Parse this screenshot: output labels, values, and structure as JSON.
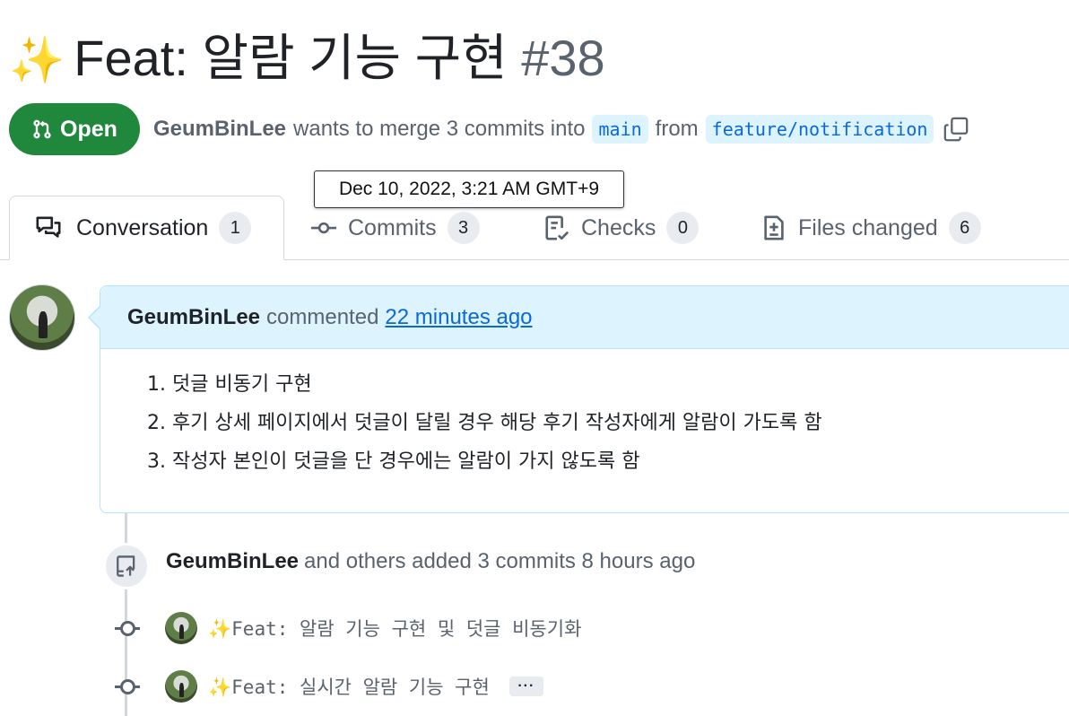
{
  "pr": {
    "title": "Feat: 알람 기능 구현",
    "title_emoji": "✨",
    "number": "#38",
    "state": "Open",
    "author": "GeumBinLee",
    "merge_text": "wants to merge 3 commits into",
    "base_branch": "main",
    "from_text": "from",
    "head_branch": "feature/notification"
  },
  "tooltip": {
    "text": "Dec 10, 2022, 3:21 AM GMT+9"
  },
  "tabs": [
    {
      "label": "Conversation",
      "count": "1",
      "icon": "comment-discussion-icon",
      "active": true
    },
    {
      "label": "Commits",
      "count": "3",
      "icon": "git-commit-icon",
      "active": false
    },
    {
      "label": "Checks",
      "count": "0",
      "icon": "checklist-icon",
      "active": false
    },
    {
      "label": "Files changed",
      "count": "6",
      "icon": "file-diff-icon",
      "active": false
    }
  ],
  "comment": {
    "author": "GeumBinLee",
    "action": "commented",
    "time": "22 minutes ago",
    "items": [
      "1. 덧글 비동기 구현",
      "2. 후기 상세 페이지에서 덧글이 달릴 경우 해당 후기 작성자에게 알람이 가도록 함",
      "3. 작성자 본인이 덧글을 단 경우에는 알람이 가지 않도록 함"
    ]
  },
  "event": {
    "author": "GeumBinLee",
    "text": "and others added 3 commits 8 hours ago"
  },
  "commits": [
    {
      "emoji": "✨",
      "message": "Feat: 알람 기능 구현 및 덧글 비동기화"
    },
    {
      "emoji": "✨",
      "message": "Feat: 실시간 알람 기능 구현",
      "ellipsis": "···"
    }
  ],
  "colors": {
    "open_green": "#1f883d",
    "link_blue": "#0969da",
    "comment_header_bg": "#ddf4ff"
  }
}
